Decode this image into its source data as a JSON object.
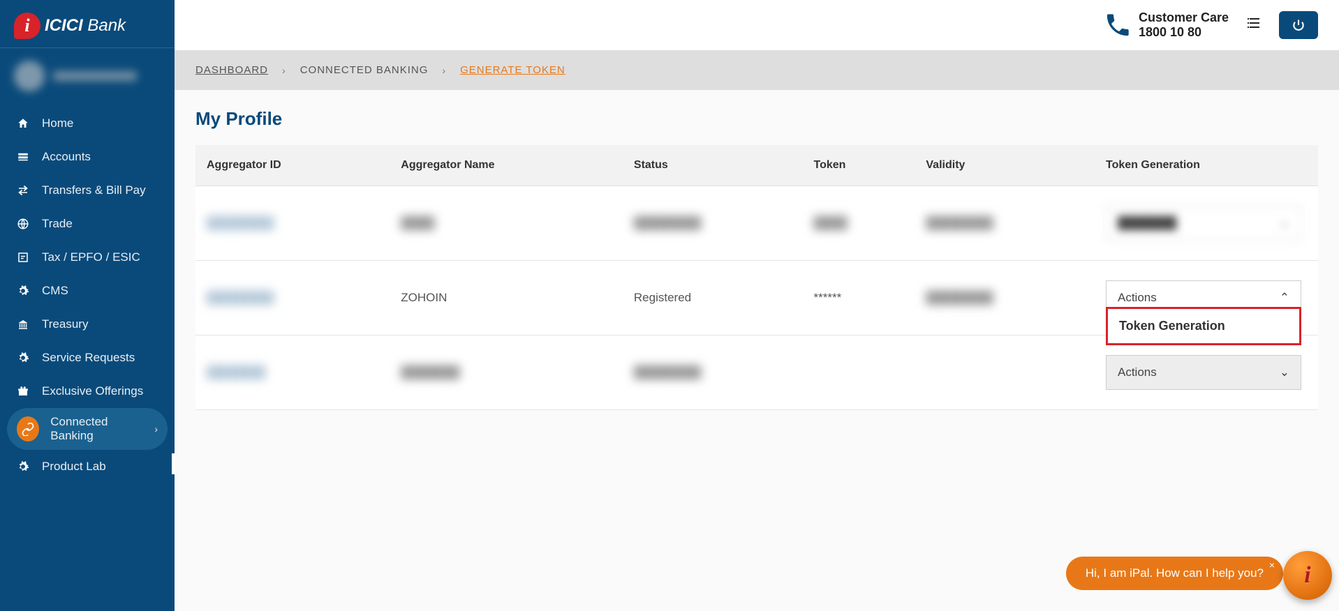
{
  "logo": {
    "brand": "ICICI",
    "suffix": "Bank"
  },
  "sidebar": {
    "items": [
      {
        "label": "Home"
      },
      {
        "label": "Accounts"
      },
      {
        "label": "Transfers & Bill Pay"
      },
      {
        "label": "Trade"
      },
      {
        "label": "Tax / EPFO / ESIC"
      },
      {
        "label": "CMS"
      },
      {
        "label": "Treasury"
      },
      {
        "label": "Service Requests"
      },
      {
        "label": "Exclusive Offerings"
      },
      {
        "label": "Connected Banking"
      },
      {
        "label": "Product Lab"
      }
    ]
  },
  "topbar": {
    "care_label": "Customer Care",
    "care_number": "1800 10 80"
  },
  "breadcrumb": {
    "dashboard": "DASHBOARD",
    "connected": "CONNECTED BANKING",
    "generate": "GENERATE TOKEN"
  },
  "page": {
    "title": "My Profile"
  },
  "table": {
    "headers": {
      "aggregator_id": "Aggregator ID",
      "aggregator_name": "Aggregator Name",
      "status": "Status",
      "token": "Token",
      "validity": "Validity",
      "token_generation": "Token Generation"
    },
    "rows": [
      {
        "aggregator_id": "",
        "aggregator_name": "",
        "status": "",
        "token": "",
        "validity": "",
        "actions_label": ""
      },
      {
        "aggregator_id": "",
        "aggregator_name": "ZOHOIN",
        "status": "Registered",
        "token": "******",
        "validity": "",
        "actions_label": "Actions",
        "dropdown_label": "Token Generation"
      },
      {
        "aggregator_id": "",
        "aggregator_name": "",
        "status": "",
        "token": "",
        "validity": "",
        "actions_label": "Actions"
      }
    ]
  },
  "ipal": {
    "text": "Hi, I am iPal. How can I help you?"
  }
}
